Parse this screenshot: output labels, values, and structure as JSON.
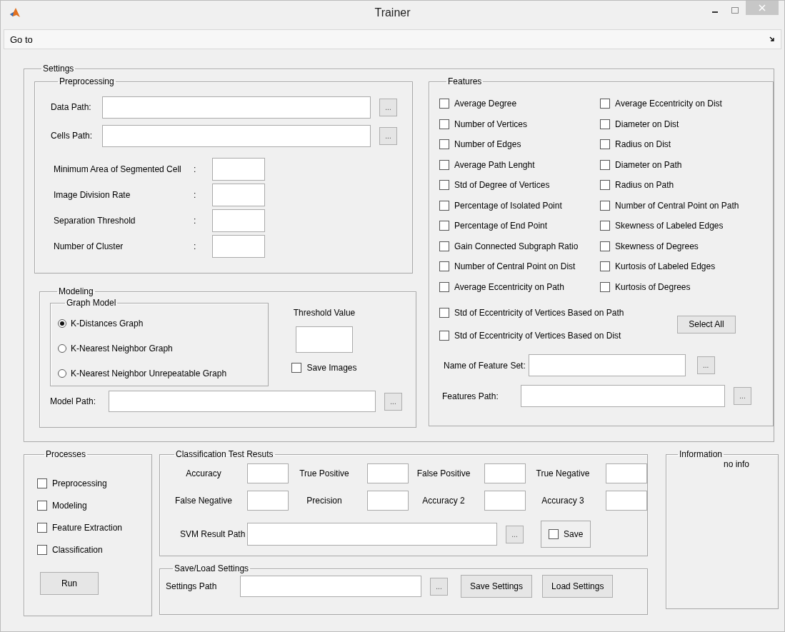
{
  "window": {
    "title": "Trainer"
  },
  "menu": [
    {
      "label": "Go to"
    }
  ],
  "settings": {
    "title": "Settings",
    "preprocessing": {
      "title": "Preprocessing",
      "path_fields": [
        {
          "label": "Data Path:",
          "browse": "..."
        },
        {
          "label": "Cells Path:",
          "browse": "..."
        }
      ],
      "params": [
        {
          "label": "Minimum Area of Segmented Cell",
          "colon": ":"
        },
        {
          "label": "Image Division Rate",
          "colon": ":"
        },
        {
          "label": "Separation Threshold",
          "colon": ":"
        },
        {
          "label": "Number of Cluster",
          "colon": ":"
        }
      ]
    },
    "modeling": {
      "title": "Modeling",
      "graph_model": {
        "title": "Graph Model",
        "options": [
          {
            "label": "K-Distances Graph",
            "selected": true
          },
          {
            "label": "K-Nearest Neighbor Graph",
            "selected": false
          },
          {
            "label": "K-Nearest Neighbor Unrepeatable Graph",
            "selected": false
          }
        ]
      },
      "threshold_label": "Threshold Value",
      "save_images": {
        "label": "Save Images",
        "checked": false
      },
      "model_path": {
        "label": "Model Path:",
        "browse": "..."
      }
    },
    "features": {
      "title": "Features",
      "left": [
        {
          "label": "Average Degree",
          "checked": false
        },
        {
          "label": "Number of Vertices",
          "checked": false
        },
        {
          "label": "Number of Edges",
          "checked": false
        },
        {
          "label": "Average Path Lenght",
          "checked": false
        },
        {
          "label": "Std of Degree of Vertices",
          "checked": false
        },
        {
          "label": "Percentage of Isolated Point",
          "checked": false
        },
        {
          "label": "Percentage of End Point",
          "checked": false
        },
        {
          "label": "Gain Connected Subgraph Ratio",
          "checked": false
        },
        {
          "label": "Number of Central Point on Dist",
          "checked": false
        },
        {
          "label": "Average Eccentricity on Path",
          "checked": false
        }
      ],
      "right": [
        {
          "label": "Average Eccentricity on Dist",
          "checked": false
        },
        {
          "label": "Diameter on Dist",
          "checked": false
        },
        {
          "label": "Radius on Dist",
          "checked": false
        },
        {
          "label": "Diameter on Path",
          "checked": false
        },
        {
          "label": "Radius on Path",
          "checked": false
        },
        {
          "label": "Number of Central Point on Path",
          "checked": false
        },
        {
          "label": "Skewness of Labeled Edges",
          "checked": false
        },
        {
          "label": "Skewness of Degrees",
          "checked": false
        },
        {
          "label": "Kurtosis of Labeled Edges",
          "checked": false
        },
        {
          "label": "Kurtosis of Degrees",
          "checked": false
        }
      ],
      "wide": [
        {
          "label": "Std of Eccentricity of Vertices Based on Path",
          "checked": false
        },
        {
          "label": "Std of Eccentricity of Vertices Based on Dist",
          "checked": false
        }
      ],
      "select_all": "Select All",
      "name_field": {
        "label": "Name of Feature Set:",
        "browse": "..."
      },
      "path_field": {
        "label": "Features Path:",
        "browse": "..."
      }
    }
  },
  "processes": {
    "title": "Processes",
    "items": [
      {
        "label": "Preprocessing",
        "checked": false
      },
      {
        "label": "Modeling",
        "checked": false
      },
      {
        "label": "Feature Extraction",
        "checked": false
      },
      {
        "label": "Classification",
        "checked": false
      }
    ],
    "run": "Run"
  },
  "classification": {
    "title": "Classification Test Resuts",
    "metrics": [
      {
        "label": "Accuracy"
      },
      {
        "label": "True Positive"
      },
      {
        "label": "False Positive"
      },
      {
        "label": "True Negative"
      },
      {
        "label": "False Negative"
      },
      {
        "label": "Precision"
      },
      {
        "label": "Accuracy 2"
      },
      {
        "label": "Accuracy 3"
      }
    ],
    "svm_path": {
      "label": "SVM Result Path",
      "browse": "..."
    },
    "save": {
      "label": "Save",
      "checked": false
    }
  },
  "save_load": {
    "title": "Save/Load Settings",
    "path": {
      "label": "Settings Path",
      "browse": "..."
    },
    "buttons": [
      "Save Settings",
      "Load Settings"
    ]
  },
  "information": {
    "title": "Information",
    "text": "no info"
  }
}
